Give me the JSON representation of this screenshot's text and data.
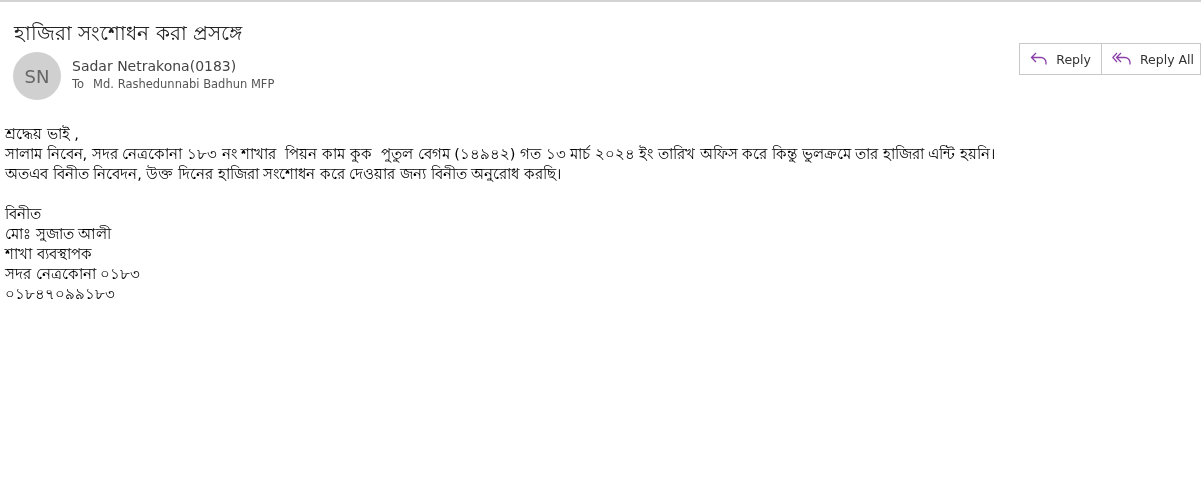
{
  "subject": "হাজিরা সংশোধন করা প্রসঙ্গে",
  "sender": {
    "initials": "SN",
    "name": "Sadar Netrakona(0183)",
    "to_label": "To",
    "to": "Md. Rashedunnabi Badhun MFP"
  },
  "actions": [
    {
      "label": "Reply",
      "kind": "reply"
    },
    {
      "label": "Reply All",
      "kind": "reply_all"
    }
  ],
  "body": [
    [
      "শ্রদ্ধেয় ভাই ,",
      "সালাম নিবেন, সদর নেত্রকোনা ১৮৩ নং শাখার  পিয়ন কাম কুক  পুতুল বেগম (১৪৯৪২) গত ১৩ মার্চ ২০২৪ ইং তারিখ অফিস করে কিন্তু ভুলক্রমে তার হাজিরা এন্টি হয়নি।",
      "অতএব বিনীত নিবেদন, উক্ত দিনের হাজিরা সংশোধন করে দেওয়ার জন্য বিনীত অনুরোধ করছি।"
    ],
    [
      "বিনীত",
      "মোঃ সুজাত আলী",
      "শাখা ব্যবস্থাপক",
      "সদর নেত্রকোনা ০১৮৩",
      "০১৮৪৭০৯৯১৮৩"
    ]
  ]
}
